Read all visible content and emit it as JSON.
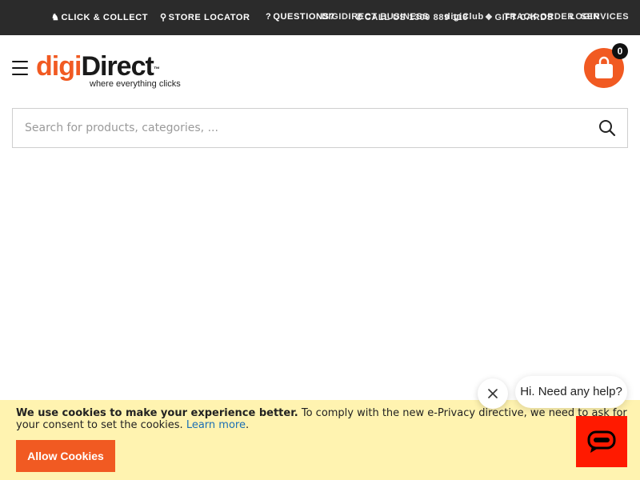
{
  "topbar": {
    "click_collect": "CLICK & COLLECT",
    "store_locator": "STORE LOCATOR",
    "questions": "QUESTIONS?",
    "digi_direct_business": "DIGIDIRECT BUSINESS",
    "call_us": "CALL US 1300 889 118",
    "digi_club": "digiClub",
    "gift_cards": "GIFT CARDS",
    "track_order": "TRACK ORDER",
    "login": "LOGIN",
    "services": "SERVICES"
  },
  "header": {
    "logo_digi": "digi",
    "logo_direct": "Direct",
    "logo_tm": "™",
    "tagline": "where everything clicks",
    "cart_count": "0"
  },
  "search": {
    "placeholder": "Search for products, categories, ..."
  },
  "cookie": {
    "bold_text": "We use cookies to make your experience better.",
    "text": " To comply with the new e-Privacy directive, we need to ask for your consent to set the cookies. ",
    "learn_more": "Learn more",
    "period": ".",
    "allow_label": "Allow Cookies"
  },
  "chat": {
    "bubble_text": "Hi. Need any help?"
  },
  "colors": {
    "accent": "#f15a22",
    "topbar": "#2b2b2b",
    "cookie_bg": "#fff3b0",
    "chat_button": "#ff1a00",
    "link": "#1a6fb5"
  },
  "icons": {
    "hamburger": "menu-icon",
    "cart": "shopping-bag-icon",
    "search": "search-icon",
    "close": "close-icon",
    "chat": "chat-icon"
  }
}
